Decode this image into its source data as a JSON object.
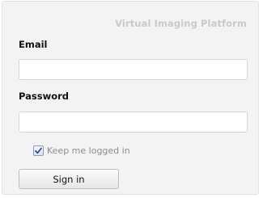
{
  "brand": {
    "text": "Virtual Imaging Platform"
  },
  "form": {
    "email": {
      "label": "Email",
      "value": "",
      "placeholder": ""
    },
    "password": {
      "label": "Password",
      "value": "",
      "placeholder": ""
    },
    "remember": {
      "label": "Keep me logged in",
      "checked": true
    },
    "submit_label": "Sign in"
  },
  "colors": {
    "panel_bg": "#f3f3f3",
    "brand_text": "#c9c9c9",
    "checkbox_check": "#2f4f9f"
  },
  "icons": {
    "remember_check": "checkmark-icon"
  }
}
